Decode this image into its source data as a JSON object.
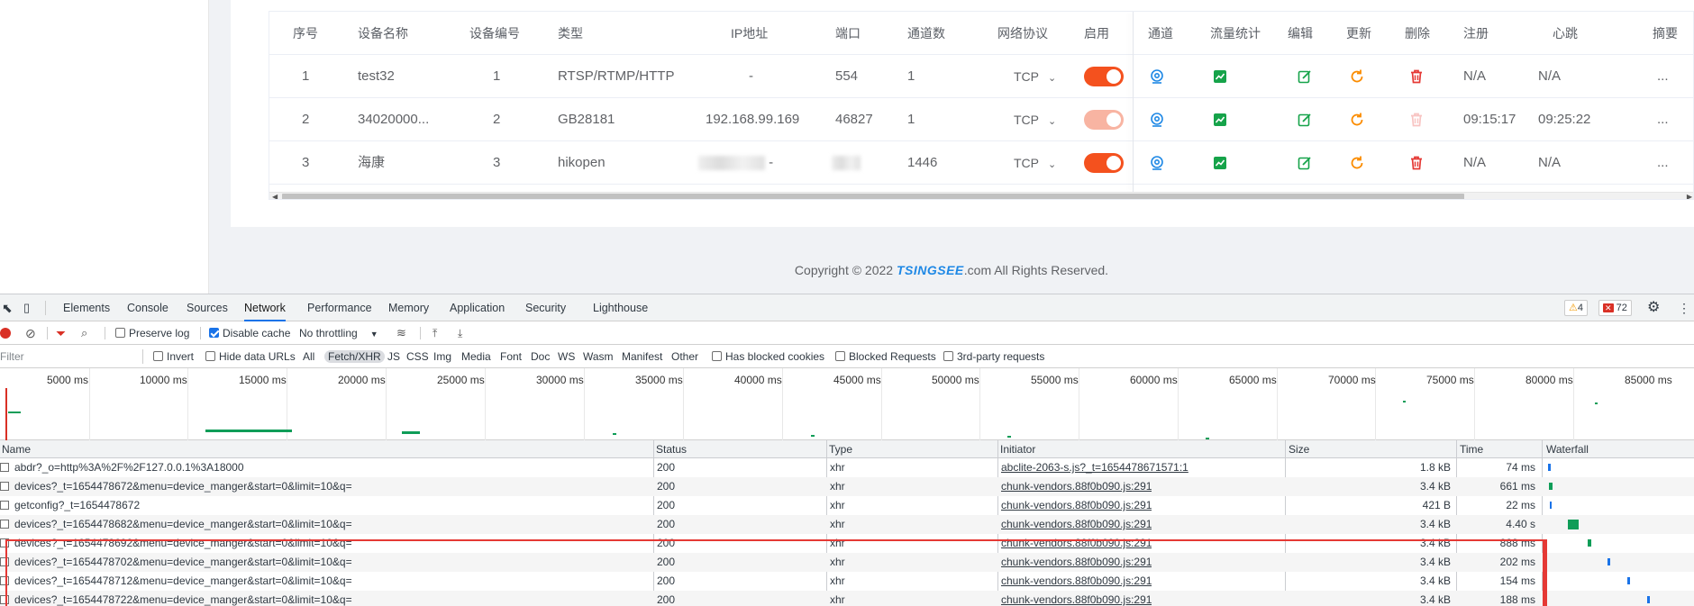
{
  "device_table": {
    "headers": [
      "序号",
      "设备名称",
      "设备编号",
      "类型",
      "IP地址",
      "端口",
      "通道数",
      "网络协议",
      "启用",
      "通道",
      "流量统计",
      "编辑",
      "更新",
      "删除",
      "注册",
      "心跳",
      "摘要"
    ],
    "rows": [
      {
        "idx": "1",
        "name": "test32",
        "code": "1",
        "type": "RTSP/RTMP/HTTP",
        "ip": "-",
        "port": "554",
        "channels": "1",
        "protocol": "TCP",
        "enabled": true,
        "register": "N/A",
        "heartbeat": "N/A",
        "summary": "..."
      },
      {
        "idx": "2",
        "name": "34020000...",
        "code": "2",
        "type": "GB28181",
        "ip": "192.168.99.169",
        "port": "46827",
        "channels": "1",
        "protocol": "TCP",
        "enabled": true,
        "register": "09:15:17",
        "heartbeat": "09:25:22",
        "summary": "..."
      },
      {
        "idx": "3",
        "name": "海康",
        "code": "3",
        "type": "hikopen",
        "ip": "-",
        "port": "",
        "channels": "1446",
        "protocol": "TCP",
        "enabled": true,
        "register": "N/A",
        "heartbeat": "N/A",
        "summary": "..."
      }
    ],
    "icons": [
      "channel-icon",
      "traffic-stats-icon",
      "edit-icon",
      "refresh-icon",
      "delete-icon"
    ]
  },
  "footer": {
    "prefix": "Copyright © 2022 ",
    "brand": "TSINGSEE",
    "suffix": ".com All Rights Reserved."
  },
  "devtools": {
    "tabs": [
      "Elements",
      "Console",
      "Sources",
      "Network",
      "Performance",
      "Memory",
      "Application",
      "Security",
      "Lighthouse"
    ],
    "active_tab": "Network",
    "warnings": "4",
    "errors": "72",
    "toolbar": {
      "preserve_log": "Preserve log",
      "disable_cache": "Disable cache",
      "throttling": "No throttling"
    },
    "filter_bar": {
      "placeholder": "Filter",
      "invert": "Invert",
      "hide_data_urls": "Hide data URLs",
      "types": [
        "All",
        "Fetch/XHR",
        "JS",
        "CSS",
        "Img",
        "Media",
        "Font",
        "Doc",
        "WS",
        "Wasm",
        "Manifest",
        "Other"
      ],
      "selected_type": "Fetch/XHR",
      "has_blocked_cookies": "Has blocked cookies",
      "blocked_requests": "Blocked Requests",
      "third_party": "3rd-party requests"
    },
    "timeline_labels": [
      "5000 ms",
      "10000 ms",
      "15000 ms",
      "20000 ms",
      "25000 ms",
      "30000 ms",
      "35000 ms",
      "40000 ms",
      "45000 ms",
      "50000 ms",
      "55000 ms",
      "60000 ms",
      "65000 ms",
      "70000 ms",
      "75000 ms",
      "80000 ms",
      "85000 ms"
    ],
    "columns": {
      "name": "Name",
      "status": "Status",
      "type": "Type",
      "initiator": "Initiator",
      "size": "Size",
      "time": "Time",
      "waterfall": "Waterfall"
    },
    "requests": [
      {
        "name": "abdr?_o=http%3A%2F%2F127.0.0.1%3A18000",
        "status": "200",
        "type": "xhr",
        "initiator": "abclite-2063-s.js?_t=1654478671571:1",
        "size": "1.8 kB",
        "time": "74 ms"
      },
      {
        "name": "devices?_t=1654478672&menu=device_manger&start=0&limit=10&q=",
        "status": "200",
        "type": "xhr",
        "initiator": "chunk-vendors.88f0b090.js:291",
        "size": "3.4 kB",
        "time": "661 ms"
      },
      {
        "name": "getconfig?_t=1654478672",
        "status": "200",
        "type": "xhr",
        "initiator": "chunk-vendors.88f0b090.js:291",
        "size": "421 B",
        "time": "22 ms"
      },
      {
        "name": "devices?_t=1654478682&menu=device_manger&start=0&limit=10&q=",
        "status": "200",
        "type": "xhr",
        "initiator": "chunk-vendors.88f0b090.js:291",
        "size": "3.4 kB",
        "time": "4.40 s"
      },
      {
        "name": "devices?_t=1654478692&menu=device_manger&start=0&limit=10&q=",
        "status": "200",
        "type": "xhr",
        "initiator": "chunk-vendors.88f0b090.js:291",
        "size": "3.4 kB",
        "time": "888 ms"
      },
      {
        "name": "devices?_t=1654478702&menu=device_manger&start=0&limit=10&q=",
        "status": "200",
        "type": "xhr",
        "initiator": "chunk-vendors.88f0b090.js:291",
        "size": "3.4 kB",
        "time": "202 ms"
      },
      {
        "name": "devices?_t=1654478712&menu=device_manger&start=0&limit=10&q=",
        "status": "200",
        "type": "xhr",
        "initiator": "chunk-vendors.88f0b090.js:291",
        "size": "3.4 kB",
        "time": "154 ms"
      },
      {
        "name": "devices?_t=1654478722&menu=device_manger&start=0&limit=10&q=",
        "status": "200",
        "type": "xhr",
        "initiator": "chunk-vendors.88f0b090.js:291",
        "size": "3.4 kB",
        "time": "188 ms"
      }
    ]
  },
  "colors": {
    "accent_orange": "#f4511e",
    "link_blue": "#1e88e5",
    "green": "#16a34a",
    "delete_red": "#e53935",
    "devtools_blue": "#1a73e8"
  }
}
